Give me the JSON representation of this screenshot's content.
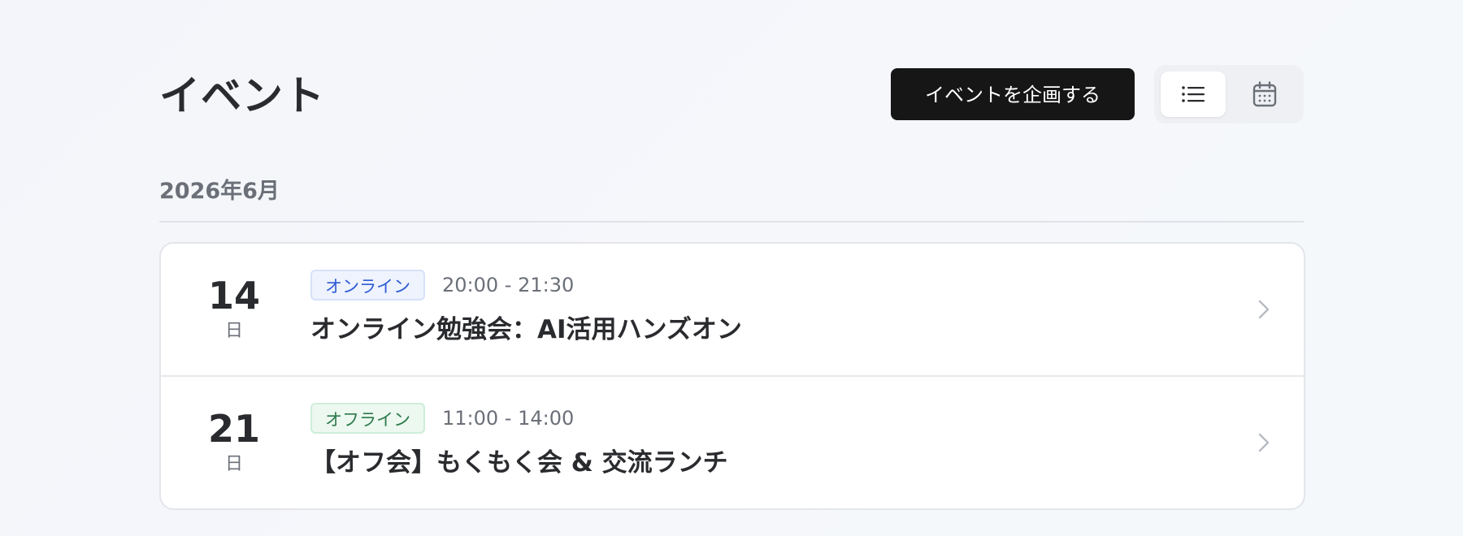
{
  "header": {
    "title": "イベント",
    "create_button_label": "イベントを企画する",
    "view_toggle": {
      "options": [
        "list-icon",
        "calendar-icon"
      ],
      "selected": "list"
    }
  },
  "month_group": {
    "label": "2026年6月",
    "events": [
      {
        "day": "14",
        "weekday": "日",
        "badge": "オンライン",
        "badge_type": "online",
        "time": "20:00 - 21:30",
        "title": "オンライン勉強会：AI活用ハンズオン"
      },
      {
        "day": "21",
        "weekday": "日",
        "badge": "オフライン",
        "badge_type": "offline",
        "time": "11:00 - 14:00",
        "title": "【オフ会】もくもく会 & 交流ランチ"
      }
    ]
  },
  "colors": {
    "primary_button": "#161616",
    "online_badge_text": "#2f5bd4",
    "offline_badge_text": "#2c7a4b"
  }
}
